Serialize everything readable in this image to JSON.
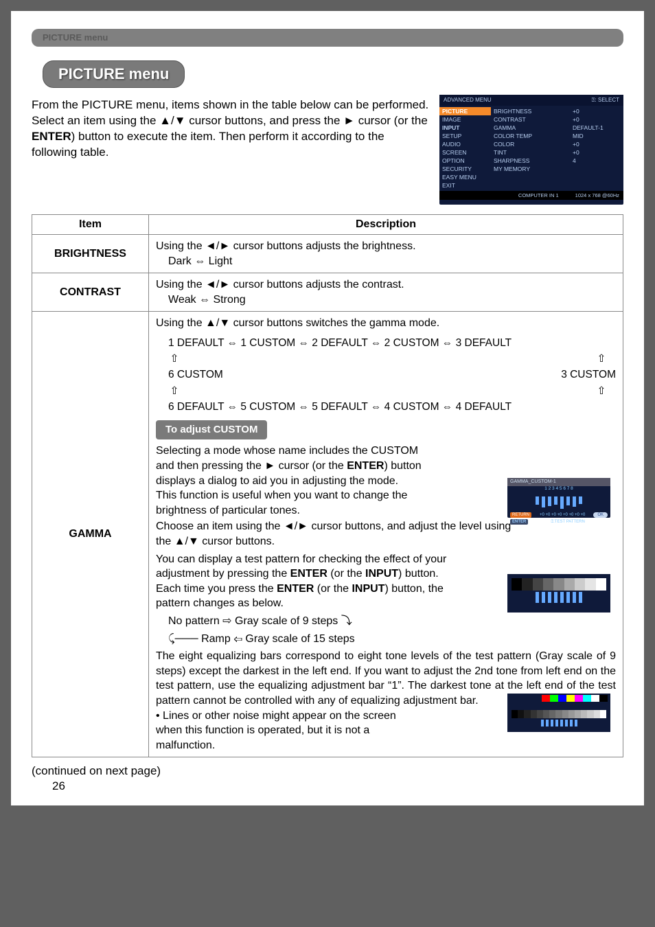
{
  "header": {
    "bar_label": "PICTURE menu",
    "title": "PICTURE menu"
  },
  "intro": "From the PICTURE menu, items shown in the table below can be performed.\nSelect an item using the ▲/▼ cursor buttons, and press the ► cursor (or the ENTER) button to execute the item. Then perform it according to the following table.",
  "menu_screenshot": {
    "top_left": "ADVANCED MENU",
    "top_right": "⍰: SELECT",
    "left_items": [
      "PICTURE",
      "IMAGE",
      "INPUT",
      "SETUP",
      "AUDIO",
      "SCREEN",
      "OPTION",
      "SECURITY",
      "EASY MENU",
      "EXIT"
    ],
    "mid_items": [
      "BRIGHTNESS",
      "CONTRAST",
      "GAMMA",
      "COLOR TEMP",
      "COLOR",
      "TINT",
      "SHARPNESS",
      "MY MEMORY"
    ],
    "right_items": [
      "+0",
      "+0",
      "DEFAULT-1",
      "MID",
      "+0",
      "+0",
      "4",
      ""
    ],
    "footer_left": "COMPUTER IN 1",
    "footer_right": "1024 x 768 @60Hz"
  },
  "table": {
    "head_item": "Item",
    "head_desc": "Description",
    "brightness": {
      "name": "BRIGHTNESS",
      "line1": "Using the ◄/► cursor buttons adjusts the brightness.",
      "line2": "Dark ⇔ Light"
    },
    "contrast": {
      "name": "CONTRAST",
      "line1": "Using the ◄/► cursor buttons adjusts the contrast.",
      "line2": "Weak ⇔ Strong"
    },
    "gamma": {
      "name": "GAMMA",
      "switch": "Using the ▲/▼ cursor buttons switches the gamma mode.",
      "chain_top": "1 DEFAULT ⇔ 1 CUSTOM ⇔ 2 DEFAULT ⇔ 2 CUSTOM  ⇔ 3 DEFAULT",
      "chain_mid_l": "6 CUSTOM",
      "chain_mid_r": "3 CUSTOM",
      "chain_bot": "6 DEFAULT ⇔ 5 CUSTOM ⇔ 5 DEFAULT ⇔ 4 CUSTOM  ⇔ 4 DEFAULT",
      "sub_title": "To adjust CUSTOM",
      "p1": "Selecting a mode whose name includes the CUSTOM and then pressing the ► cursor (or the ENTER) button displays a dialog to aid you in adjusting the mode.\nThis function is useful when you want to change the brightness of particular tones.",
      "p2": "Choose an item using the ◄/► cursor buttons, and adjust the level using the ▲/▼ cursor buttons.",
      "p3": "You can display a test pattern for checking the effect of your adjustment by pressing the ENTER (or the INPUT) button. Each time you press the ENTER (or the INPUT) button, the pattern changes as below.",
      "pat1": "No pattern ⇨ Gray scale of 9 steps",
      "pat2": "Ramp ⇦ Gray scale of 15 steps",
      "p4": "The eight equalizing bars correspond to eight tone levels of the test pattern (Gray scale of 9 steps) except the darkest in the left end. If you want to adjust the 2nd tone from left end on the test pattern, use the equalizing adjustment bar “1”. The darkest tone at the left end of the test pattern cannot be controlled with any of equalizing adjustment bar.",
      "bullet": "• Lines or other noise might appear on the screen when this function is operated, but it is not a malfunction.",
      "dlg": {
        "title": "GAMMA_CUSTOM-1",
        "nums": "1  2  3  4  5  6  7  8",
        "zeros": "+0  +0  +0  +0  +0  +0  +0  +0",
        "return": "RETURN",
        "enter": "ENTER",
        "test": "⍰:TEST PATTERN",
        "ok": "OK"
      }
    }
  },
  "footer": {
    "continued": "(continued on next page)",
    "page": "26"
  }
}
